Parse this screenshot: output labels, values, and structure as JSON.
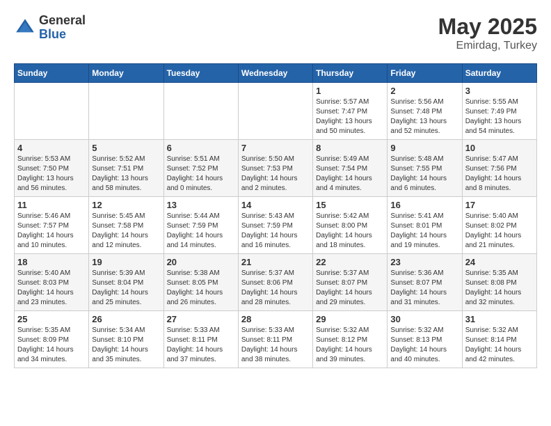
{
  "header": {
    "logo_general": "General",
    "logo_blue": "Blue",
    "month": "May 2025",
    "location": "Emirdag, Turkey"
  },
  "weekdays": [
    "Sunday",
    "Monday",
    "Tuesday",
    "Wednesday",
    "Thursday",
    "Friday",
    "Saturday"
  ],
  "weeks": [
    [
      {
        "day": "",
        "info": ""
      },
      {
        "day": "",
        "info": ""
      },
      {
        "day": "",
        "info": ""
      },
      {
        "day": "",
        "info": ""
      },
      {
        "day": "1",
        "info": "Sunrise: 5:57 AM\nSunset: 7:47 PM\nDaylight: 13 hours\nand 50 minutes."
      },
      {
        "day": "2",
        "info": "Sunrise: 5:56 AM\nSunset: 7:48 PM\nDaylight: 13 hours\nand 52 minutes."
      },
      {
        "day": "3",
        "info": "Sunrise: 5:55 AM\nSunset: 7:49 PM\nDaylight: 13 hours\nand 54 minutes."
      }
    ],
    [
      {
        "day": "4",
        "info": "Sunrise: 5:53 AM\nSunset: 7:50 PM\nDaylight: 13 hours\nand 56 minutes."
      },
      {
        "day": "5",
        "info": "Sunrise: 5:52 AM\nSunset: 7:51 PM\nDaylight: 13 hours\nand 58 minutes."
      },
      {
        "day": "6",
        "info": "Sunrise: 5:51 AM\nSunset: 7:52 PM\nDaylight: 14 hours\nand 0 minutes."
      },
      {
        "day": "7",
        "info": "Sunrise: 5:50 AM\nSunset: 7:53 PM\nDaylight: 14 hours\nand 2 minutes."
      },
      {
        "day": "8",
        "info": "Sunrise: 5:49 AM\nSunset: 7:54 PM\nDaylight: 14 hours\nand 4 minutes."
      },
      {
        "day": "9",
        "info": "Sunrise: 5:48 AM\nSunset: 7:55 PM\nDaylight: 14 hours\nand 6 minutes."
      },
      {
        "day": "10",
        "info": "Sunrise: 5:47 AM\nSunset: 7:56 PM\nDaylight: 14 hours\nand 8 minutes."
      }
    ],
    [
      {
        "day": "11",
        "info": "Sunrise: 5:46 AM\nSunset: 7:57 PM\nDaylight: 14 hours\nand 10 minutes."
      },
      {
        "day": "12",
        "info": "Sunrise: 5:45 AM\nSunset: 7:58 PM\nDaylight: 14 hours\nand 12 minutes."
      },
      {
        "day": "13",
        "info": "Sunrise: 5:44 AM\nSunset: 7:59 PM\nDaylight: 14 hours\nand 14 minutes."
      },
      {
        "day": "14",
        "info": "Sunrise: 5:43 AM\nSunset: 7:59 PM\nDaylight: 14 hours\nand 16 minutes."
      },
      {
        "day": "15",
        "info": "Sunrise: 5:42 AM\nSunset: 8:00 PM\nDaylight: 14 hours\nand 18 minutes."
      },
      {
        "day": "16",
        "info": "Sunrise: 5:41 AM\nSunset: 8:01 PM\nDaylight: 14 hours\nand 19 minutes."
      },
      {
        "day": "17",
        "info": "Sunrise: 5:40 AM\nSunset: 8:02 PM\nDaylight: 14 hours\nand 21 minutes."
      }
    ],
    [
      {
        "day": "18",
        "info": "Sunrise: 5:40 AM\nSunset: 8:03 PM\nDaylight: 14 hours\nand 23 minutes."
      },
      {
        "day": "19",
        "info": "Sunrise: 5:39 AM\nSunset: 8:04 PM\nDaylight: 14 hours\nand 25 minutes."
      },
      {
        "day": "20",
        "info": "Sunrise: 5:38 AM\nSunset: 8:05 PM\nDaylight: 14 hours\nand 26 minutes."
      },
      {
        "day": "21",
        "info": "Sunrise: 5:37 AM\nSunset: 8:06 PM\nDaylight: 14 hours\nand 28 minutes."
      },
      {
        "day": "22",
        "info": "Sunrise: 5:37 AM\nSunset: 8:07 PM\nDaylight: 14 hours\nand 29 minutes."
      },
      {
        "day": "23",
        "info": "Sunrise: 5:36 AM\nSunset: 8:07 PM\nDaylight: 14 hours\nand 31 minutes."
      },
      {
        "day": "24",
        "info": "Sunrise: 5:35 AM\nSunset: 8:08 PM\nDaylight: 14 hours\nand 32 minutes."
      }
    ],
    [
      {
        "day": "25",
        "info": "Sunrise: 5:35 AM\nSunset: 8:09 PM\nDaylight: 14 hours\nand 34 minutes."
      },
      {
        "day": "26",
        "info": "Sunrise: 5:34 AM\nSunset: 8:10 PM\nDaylight: 14 hours\nand 35 minutes."
      },
      {
        "day": "27",
        "info": "Sunrise: 5:33 AM\nSunset: 8:11 PM\nDaylight: 14 hours\nand 37 minutes."
      },
      {
        "day": "28",
        "info": "Sunrise: 5:33 AM\nSunset: 8:11 PM\nDaylight: 14 hours\nand 38 minutes."
      },
      {
        "day": "29",
        "info": "Sunrise: 5:32 AM\nSunset: 8:12 PM\nDaylight: 14 hours\nand 39 minutes."
      },
      {
        "day": "30",
        "info": "Sunrise: 5:32 AM\nSunset: 8:13 PM\nDaylight: 14 hours\nand 40 minutes."
      },
      {
        "day": "31",
        "info": "Sunrise: 5:32 AM\nSunset: 8:14 PM\nDaylight: 14 hours\nand 42 minutes."
      }
    ]
  ]
}
